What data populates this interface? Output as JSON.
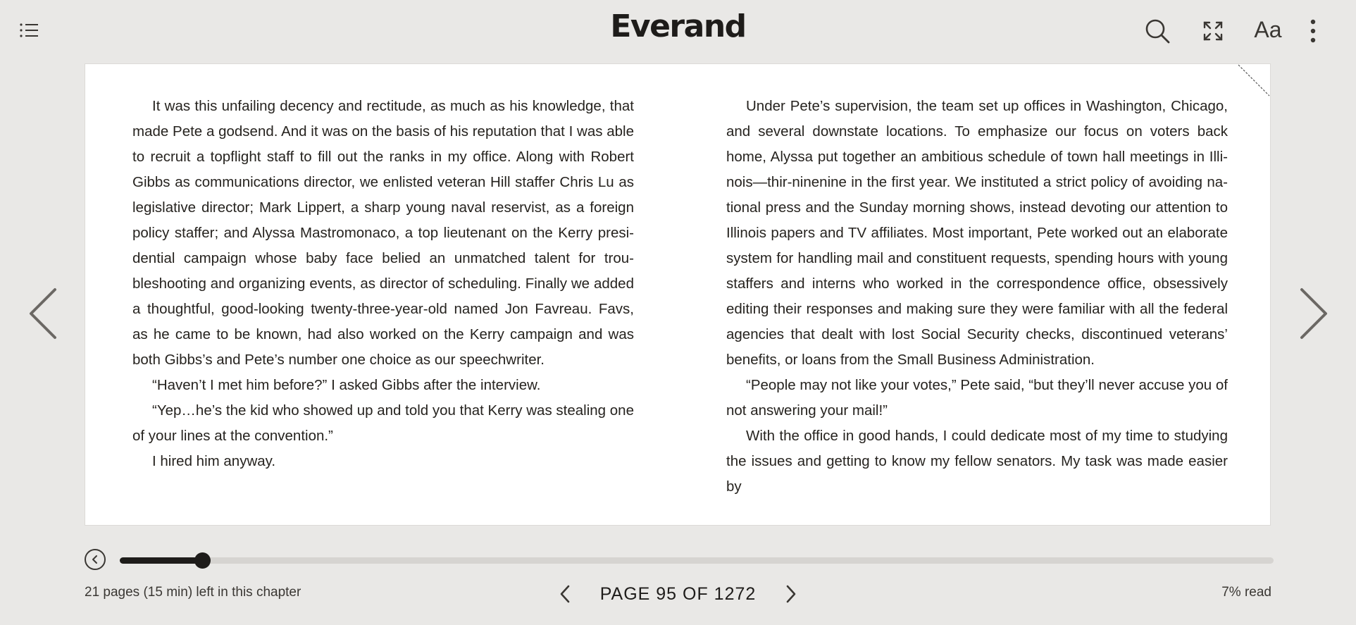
{
  "header": {
    "logo": "Everand",
    "icons": [
      "table-of-contents-icon",
      "search-icon",
      "fullscreen-icon",
      "text-settings-icon",
      "more-options-icon"
    ],
    "text_settings_label": "Aa"
  },
  "book": {
    "left_column": [
      "It was this unfailing decency and rectitude, as much as his knowledge, that made Pete a godsend. And it was on the basis of his reputation that I was able to recruit a topflight staff to fill out the ranks in my office. Along with Robert Gibbs as communications director, we enlisted veteran Hill staffer Chris Lu as legislative director; Mark Lippert, a sharp young naval reservist, as a foreign policy staffer; and Alyssa Mastromonaco, a top lieutenant on the Kerry presi­dential campaign whose baby face belied an unmatched talent for trou­bleshooting and organizing events, as director of scheduling. Finally we added a thoughtful, good-looking twenty-three-year-old named Jon Favreau. Favs, as he came to be known, had also worked on the Kerry campaign and was both Gibbs’s and Pete’s number one choice as our speechwriter.",
      "“Haven’t I met him before?” I asked Gibbs after the interview.",
      "“Yep…he’s the kid who showed up and told you that Kerry was stealing one of your lines at the convention.”",
      "I hired him anyway."
    ],
    "right_column": [
      "Under Pete’s supervision, the team set up offices in Washington, Chicago, and several downstate locations. To emphasize our focus on voters back home, Alyssa put together an ambitious schedule of town hall meetings in Illi­nois—thir-ninenine in the first year. We instituted a strict policy of avoiding na­tional press and the Sunday morning shows, instead devoting our attention to Illinois papers and TV affiliates. Most important, Pete worked out an elaborate system for handling mail and constituent requests, spending hours with young staffers and interns who worked in the correspondence office, obsessively edit­ing their responses and making sure they were familiar with all the federal agencies that dealt with lost Social Security checks, discontinued veterans’ benefits, or loans from the Small Business Administration.",
      "“People may not like your votes,” Pete said, “but they’ll never accuse you of not answering your mail!”",
      "With the office in good hands, I could dedicate most of my time to studying the issues and getting to know my fellow senators. My task was made easier by"
    ]
  },
  "progress": {
    "fraction": 0.072
  },
  "footer": {
    "chapter_left": "21 pages (15 min) left in this chapter",
    "page_label": "PAGE 95 OF 1272",
    "percent_read": "7% read"
  }
}
